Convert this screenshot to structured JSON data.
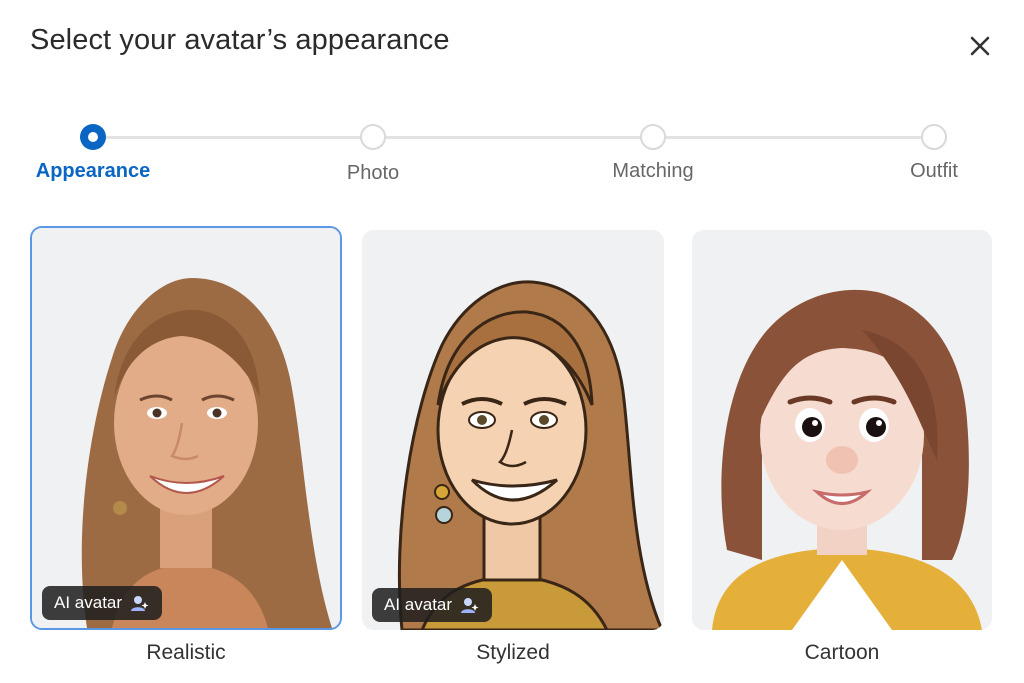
{
  "dialog": {
    "title": "Select your avatar’s appearance",
    "close_icon": "close-icon"
  },
  "stepper": {
    "steps": [
      {
        "label": "Appearance",
        "state": "active"
      },
      {
        "label": "Photo",
        "state": "inactive"
      },
      {
        "label": "Matching",
        "state": "inactive"
      },
      {
        "label": "Outfit",
        "state": "inactive"
      }
    ]
  },
  "cards": [
    {
      "label": "Realistic",
      "badge": "AI avatar",
      "selected": true
    },
    {
      "label": "Stylized",
      "badge": "AI avatar",
      "selected": false
    },
    {
      "label": "Cartoon",
      "selected": false
    }
  ],
  "colors": {
    "accent": "#0a66c2",
    "selected_border": "#5b97e4",
    "card_bg": "#f1f2f4",
    "badge_bg": "#1e1e1e"
  }
}
